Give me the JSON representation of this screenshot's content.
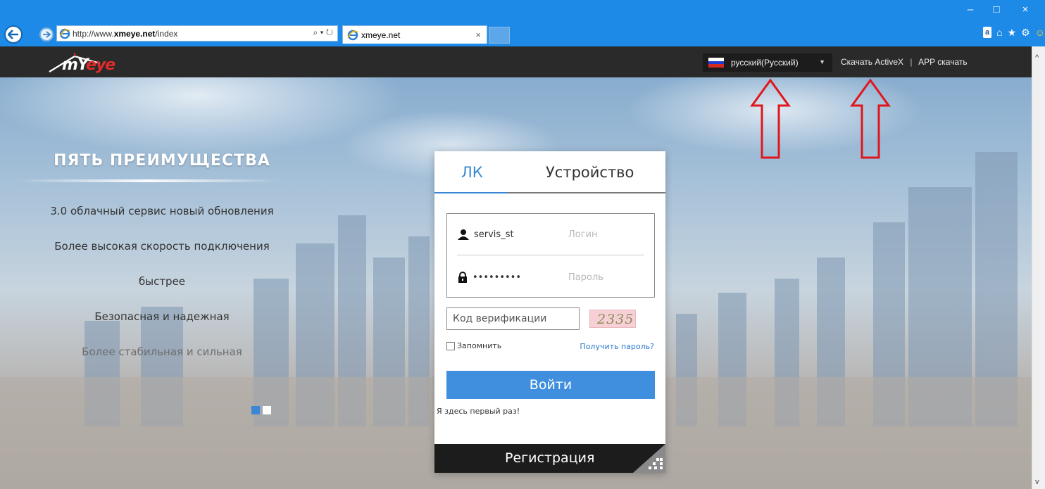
{
  "browser": {
    "url_prefix": "http://www.",
    "url_domain": "xmeye.net",
    "url_suffix": "/index",
    "url_tools": "⌕ ▾ ↻",
    "tab_title": "xmeye.net",
    "tab_close": "×",
    "window_minimize": "–",
    "window_maximize": "□",
    "window_close": "×",
    "toolbar_icons": [
      "amazon-icon",
      "home-icon",
      "star-icon",
      "gear-icon",
      "smiley-icon"
    ]
  },
  "header": {
    "logo_text_a": "mY",
    "logo_text_b": "eye",
    "language": "русский(Русский)",
    "language_caret": "▼",
    "download_activex": "Скачать ActiveX",
    "separator": "|",
    "app_download": "APP скачать"
  },
  "promo": {
    "title": "ПЯТЬ ПРЕИМУЩЕСТВА",
    "items": [
      "3.0 облачный сервис новый обновления",
      "Более высокая скорость подключения",
      "быстрее",
      "Безопасная и надежная",
      "Более стабильная и сильная"
    ],
    "active_slide": 1,
    "slide_count": 2
  },
  "login": {
    "tab_account": "ЛК",
    "tab_device": "Устройство",
    "username_value": "servis_st",
    "username_placeholder": "Логин",
    "password_value": "•••••••••",
    "password_placeholder": "Пароль",
    "verification_placeholder": "Код верификации",
    "captcha_text": "2335",
    "remember_label": "Запомнить",
    "forgot_link": "Получить пароль?",
    "login_button": "Войти",
    "first_time": "Я здесь первый раз!",
    "register_button": "Регистрация"
  },
  "colors": {
    "browser_chrome": "#1e8ae8",
    "topbar": "#2a2a2a",
    "accent_blue": "#3f8fde",
    "annotation_arrow": "#e0161c",
    "logo_red": "#e02b2b"
  }
}
